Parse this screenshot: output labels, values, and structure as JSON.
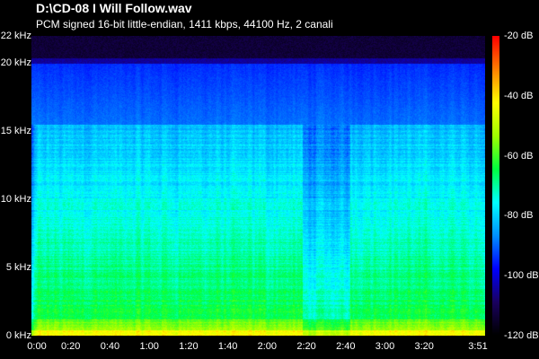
{
  "window": {
    "file_title": "D:\\CD-08 I Will Follow.wav",
    "format_line": "PCM signed 16-bit little-endian, 1411 kbps, 44100 Hz, 2 canali"
  },
  "frequency_axis": {
    "unit": "kHz",
    "max_khz": 22,
    "ticks": [
      {
        "value": 22,
        "label": "22 kHz"
      },
      {
        "value": 20,
        "label": "20 kHz"
      },
      {
        "value": 15,
        "label": "15 kHz"
      },
      {
        "value": 10,
        "label": "10 kHz"
      },
      {
        "value": 5,
        "label": "5 kHz"
      },
      {
        "value": 0,
        "label": "0 kHz"
      }
    ]
  },
  "time_axis": {
    "duration_seconds": 231,
    "ticks": [
      {
        "value": 0,
        "label": "0:00"
      },
      {
        "value": 20,
        "label": "0:20"
      },
      {
        "value": 40,
        "label": "0:40"
      },
      {
        "value": 60,
        "label": "1:00"
      },
      {
        "value": 80,
        "label": "1:20"
      },
      {
        "value": 100,
        "label": "1:40"
      },
      {
        "value": 120,
        "label": "2:00"
      },
      {
        "value": 140,
        "label": "2:20"
      },
      {
        "value": 160,
        "label": "2:40"
      },
      {
        "value": 180,
        "label": "3:00"
      },
      {
        "value": 200,
        "label": "3:20"
      },
      {
        "value": 231,
        "label": "3:51"
      }
    ]
  },
  "level_scale": {
    "min_db": -120,
    "max_db": -20,
    "ticks": [
      {
        "value": -20,
        "label": "-20 dB"
      },
      {
        "value": -40,
        "label": "-40 dB"
      },
      {
        "value": -60,
        "label": "-60 dB"
      },
      {
        "value": -80,
        "label": "-80 dB"
      },
      {
        "value": -100,
        "label": "-100 dB"
      },
      {
        "value": -120,
        "label": "-120 dB"
      }
    ],
    "colors": [
      "#000000",
      "#1a0060",
      "#0000ff",
      "#0090ff",
      "#00ffff",
      "#00ff40",
      "#a0ff00",
      "#ffff00",
      "#ff8000",
      "#ff0000"
    ]
  },
  "spectrogram": {
    "lowpass_cutoff_khz": 20,
    "secondary_rolloff_khz": 15.5,
    "quiet_section_seconds": [
      138,
      162
    ]
  }
}
